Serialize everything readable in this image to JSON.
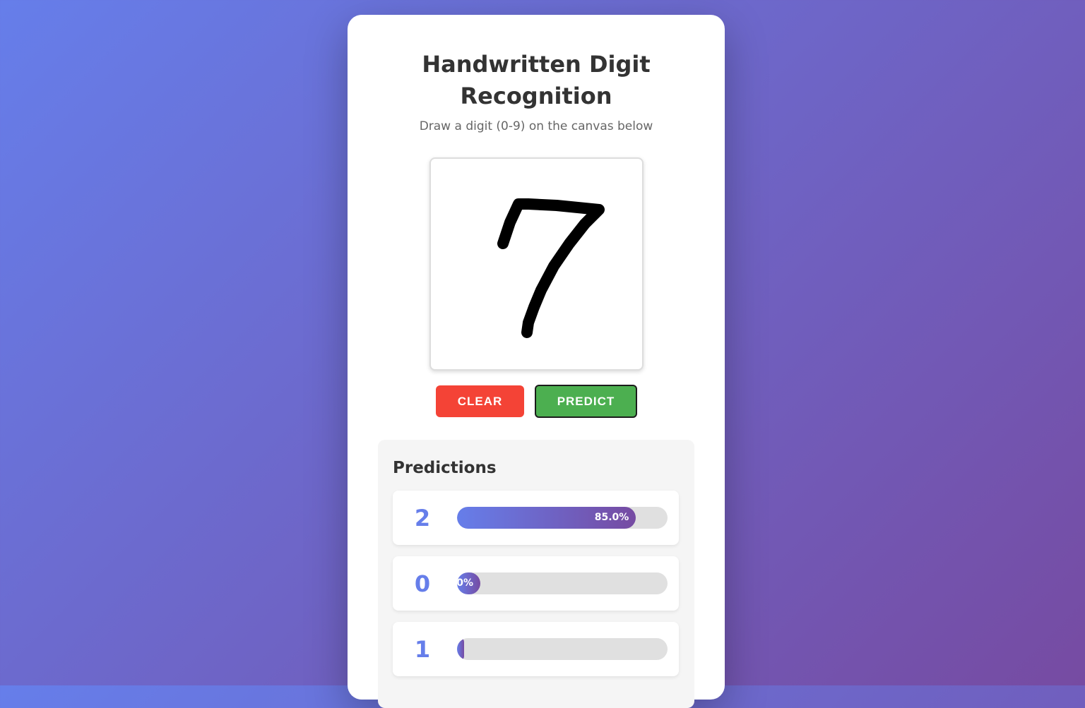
{
  "app": {
    "title": "Handwritten Digit Recognition",
    "subtitle": "Draw a digit (0-9) on the canvas below"
  },
  "canvas": {
    "drawn_stroke_color": "#000000"
  },
  "controls": {
    "clear_label": "CLEAR",
    "predict_label": "PREDICT"
  },
  "predictions": {
    "title": "Predictions",
    "items": [
      {
        "digit": "2",
        "confidence": 0.85,
        "label": "85.0%"
      },
      {
        "digit": "0",
        "confidence": 0.0,
        "label": "0%"
      },
      {
        "digit": "1",
        "confidence": 0.0,
        "label": ""
      }
    ]
  },
  "colors": {
    "background_start": "#667eea",
    "background_end": "#764ba2",
    "clear_button": "#f44336",
    "predict_button": "#4caf50",
    "digit_text": "#667eea"
  }
}
